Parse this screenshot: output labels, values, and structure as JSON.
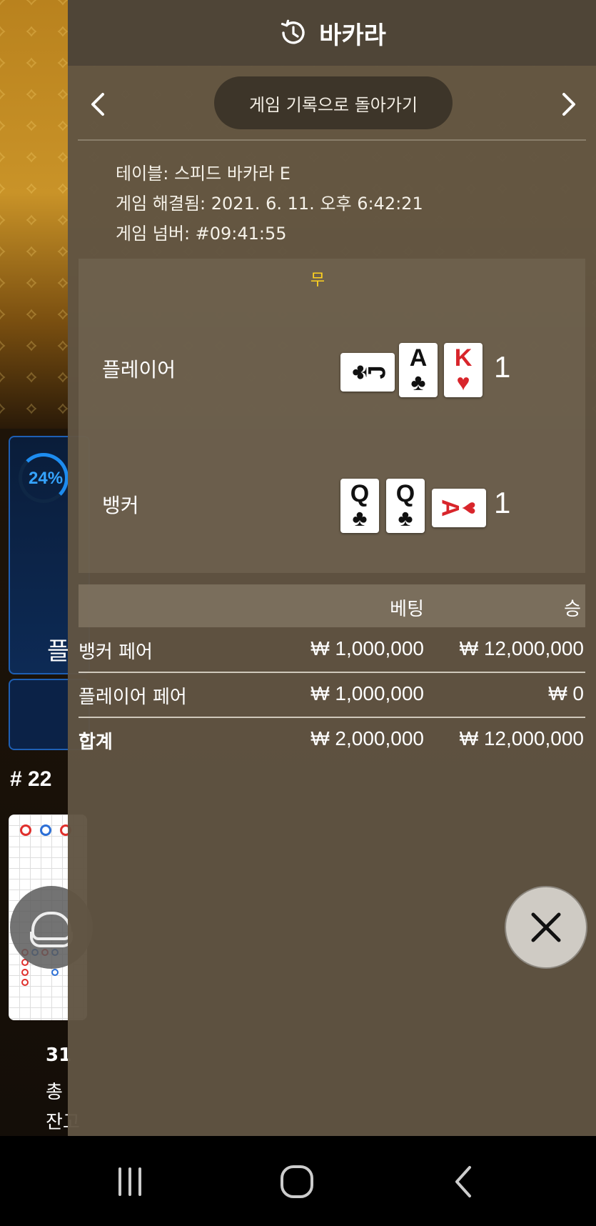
{
  "background": {
    "progress_percent": "24%",
    "panel_label": "플",
    "round_label": "# 22",
    "footer_line1": "31",
    "footer_line2": "총",
    "footer_line3": "잔고"
  },
  "header": {
    "title": "바카라",
    "icon": "history-icon"
  },
  "nav": {
    "back_to_history": "게임 기록으로 돌아가기",
    "prev_icon": "chevron-left-icon",
    "next_icon": "chevron-right-icon"
  },
  "game_info": {
    "table": "테이블: 스피드 바카라 E",
    "resolved": "게임 해결됨: 2021. 6. 11. 오후 6:42:21",
    "number": "게임 넘버: #09:41:55"
  },
  "result": {
    "outcome": "무",
    "player": {
      "label": "플레이어",
      "score": "1",
      "cards": [
        {
          "rank": "J",
          "suit": "♣",
          "color": "black",
          "orientation": "sideways"
        },
        {
          "rank": "A",
          "suit": "♣",
          "color": "black",
          "orientation": "upright"
        },
        {
          "rank": "K",
          "suit": "♥",
          "color": "red",
          "orientation": "upright"
        }
      ]
    },
    "banker": {
      "label": "뱅커",
      "score": "1",
      "cards": [
        {
          "rank": "Q",
          "suit": "♣",
          "color": "black",
          "orientation": "upright"
        },
        {
          "rank": "Q",
          "suit": "♣",
          "color": "black",
          "orientation": "upright"
        },
        {
          "rank": "A",
          "suit": "♥",
          "color": "red",
          "orientation": "sideways"
        }
      ]
    }
  },
  "bets_table": {
    "headers": {
      "bet": "베팅",
      "win": "승"
    },
    "rows": [
      {
        "name": "뱅커 페어",
        "bet": "₩ 1,000,000",
        "win": "₩ 12,000,000"
      },
      {
        "name": "플레이어 페어",
        "bet": "₩ 1,000,000",
        "win": "₩ 0"
      }
    ],
    "total": {
      "name": "합계",
      "bet": "₩ 2,000,000",
      "win": "₩ 12,000,000"
    }
  },
  "colors": {
    "outcome": "#ffd21f",
    "panel": "#605442",
    "header": "#4f4537",
    "accent_blue": "#1d8cf0"
  },
  "system_nav": {
    "recents_icon": "recents-icon",
    "home_icon": "home-icon",
    "back_icon": "back-icon"
  }
}
